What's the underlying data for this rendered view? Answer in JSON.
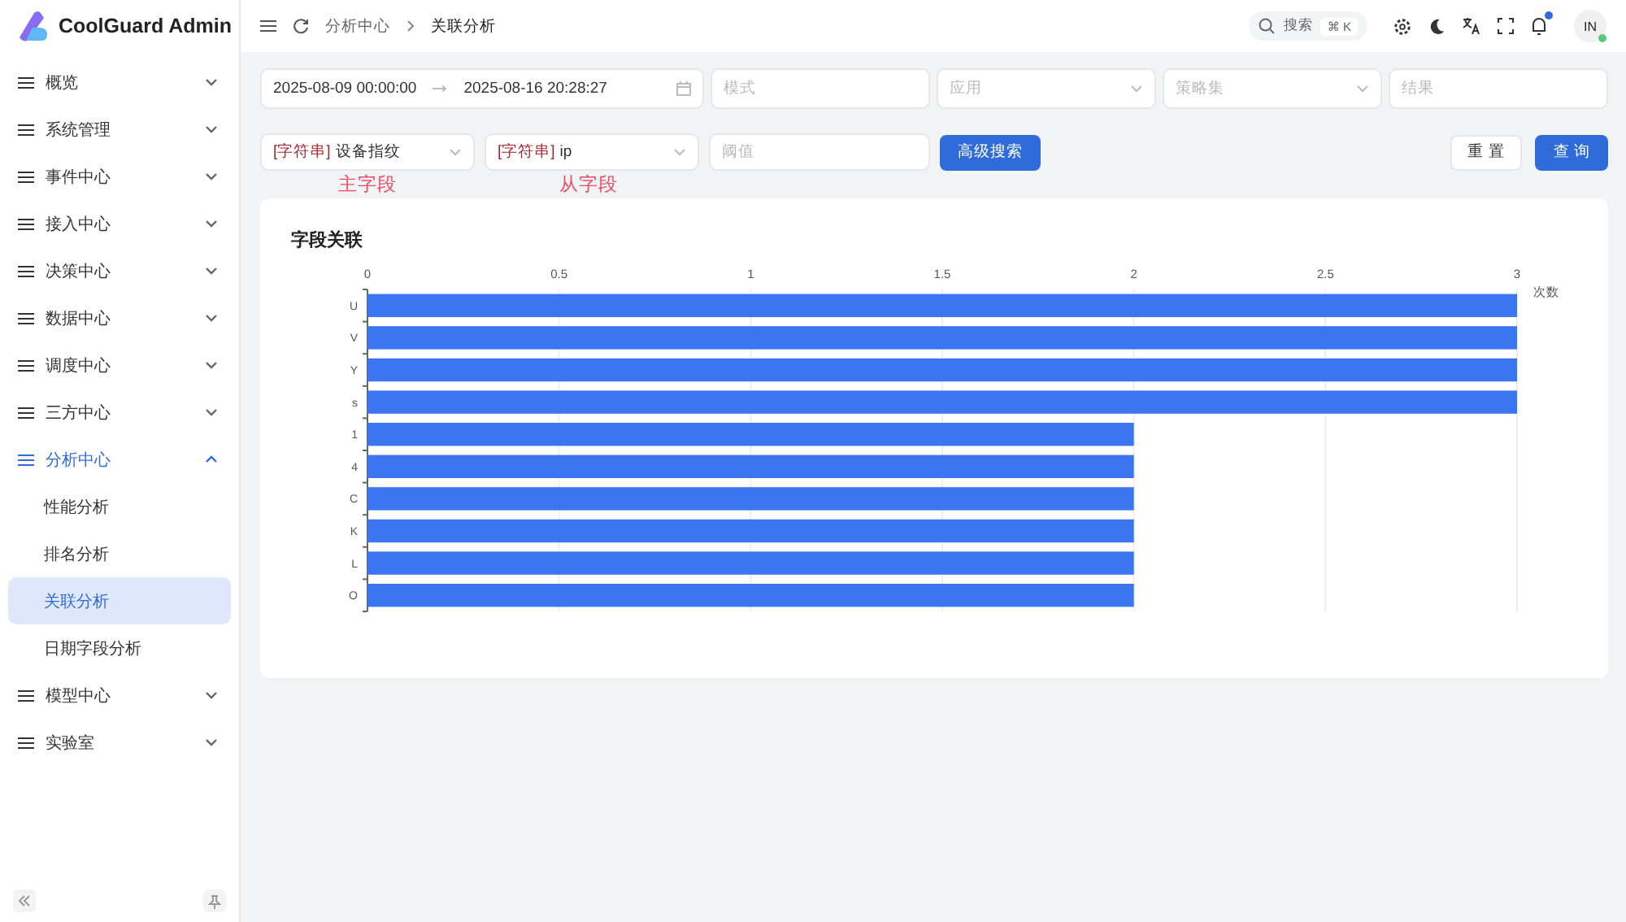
{
  "app": {
    "title": "CoolGuard Admin"
  },
  "sidebar": {
    "items": [
      {
        "label": "概览",
        "expanded": false
      },
      {
        "label": "系统管理",
        "expanded": false
      },
      {
        "label": "事件中心",
        "expanded": false
      },
      {
        "label": "接入中心",
        "expanded": false
      },
      {
        "label": "决策中心",
        "expanded": false
      },
      {
        "label": "数据中心",
        "expanded": false
      },
      {
        "label": "调度中心",
        "expanded": false
      },
      {
        "label": "三方中心",
        "expanded": false
      },
      {
        "label": "分析中心",
        "expanded": true,
        "children": [
          {
            "label": "性能分析",
            "selected": false
          },
          {
            "label": "排名分析",
            "selected": false
          },
          {
            "label": "关联分析",
            "selected": true
          },
          {
            "label": "日期字段分析",
            "selected": false
          }
        ]
      },
      {
        "label": "模型中心",
        "expanded": false
      },
      {
        "label": "实验室",
        "expanded": false
      }
    ]
  },
  "header": {
    "breadcrumb": [
      "分析中心",
      "关联分析"
    ],
    "search": {
      "placeholder": "搜索",
      "shortcut": "⌘ K"
    },
    "notification_unread": true,
    "avatar": "IN",
    "online": true
  },
  "filters": {
    "date_range": {
      "start": "2025-08-09 00:00:00",
      "end": "2025-08-16 20:28:27"
    },
    "fields": [
      {
        "placeholder": "模式",
        "kind": "input"
      },
      {
        "placeholder": "应用",
        "kind": "select"
      },
      {
        "placeholder": "策略集",
        "kind": "select"
      },
      {
        "placeholder": "结果",
        "kind": "input"
      }
    ],
    "selects": [
      {
        "tag": "[字符串]",
        "value": "设备指纹"
      },
      {
        "tag": "[字符串]",
        "value": "ip"
      }
    ],
    "threshold": {
      "placeholder": "阈值"
    },
    "advanced_button": "高级搜索",
    "reset_button": "重 置",
    "query_button": "查 询"
  },
  "annotations": [
    {
      "text": "主字段",
      "color": "#ea4d6a"
    },
    {
      "text": "从字段",
      "color": "#ea4d6a"
    }
  ],
  "card": {
    "title": "字段关联",
    "chart_data": {
      "type": "bar",
      "orientation": "horizontal",
      "xlabel": "次数",
      "categories": [
        "U",
        "V",
        "Y",
        "s",
        "1",
        "4",
        "C",
        "K",
        "L",
        "O"
      ],
      "series": [
        {
          "color": "#3b75f2",
          "values": [
            3,
            3,
            3,
            3,
            2,
            2,
            2,
            2,
            2,
            2
          ]
        }
      ],
      "grid": true,
      "xlim": [
        0,
        3
      ],
      "xticks": [
        0,
        0.5,
        1,
        1.5,
        2,
        2.5,
        3
      ]
    }
  }
}
